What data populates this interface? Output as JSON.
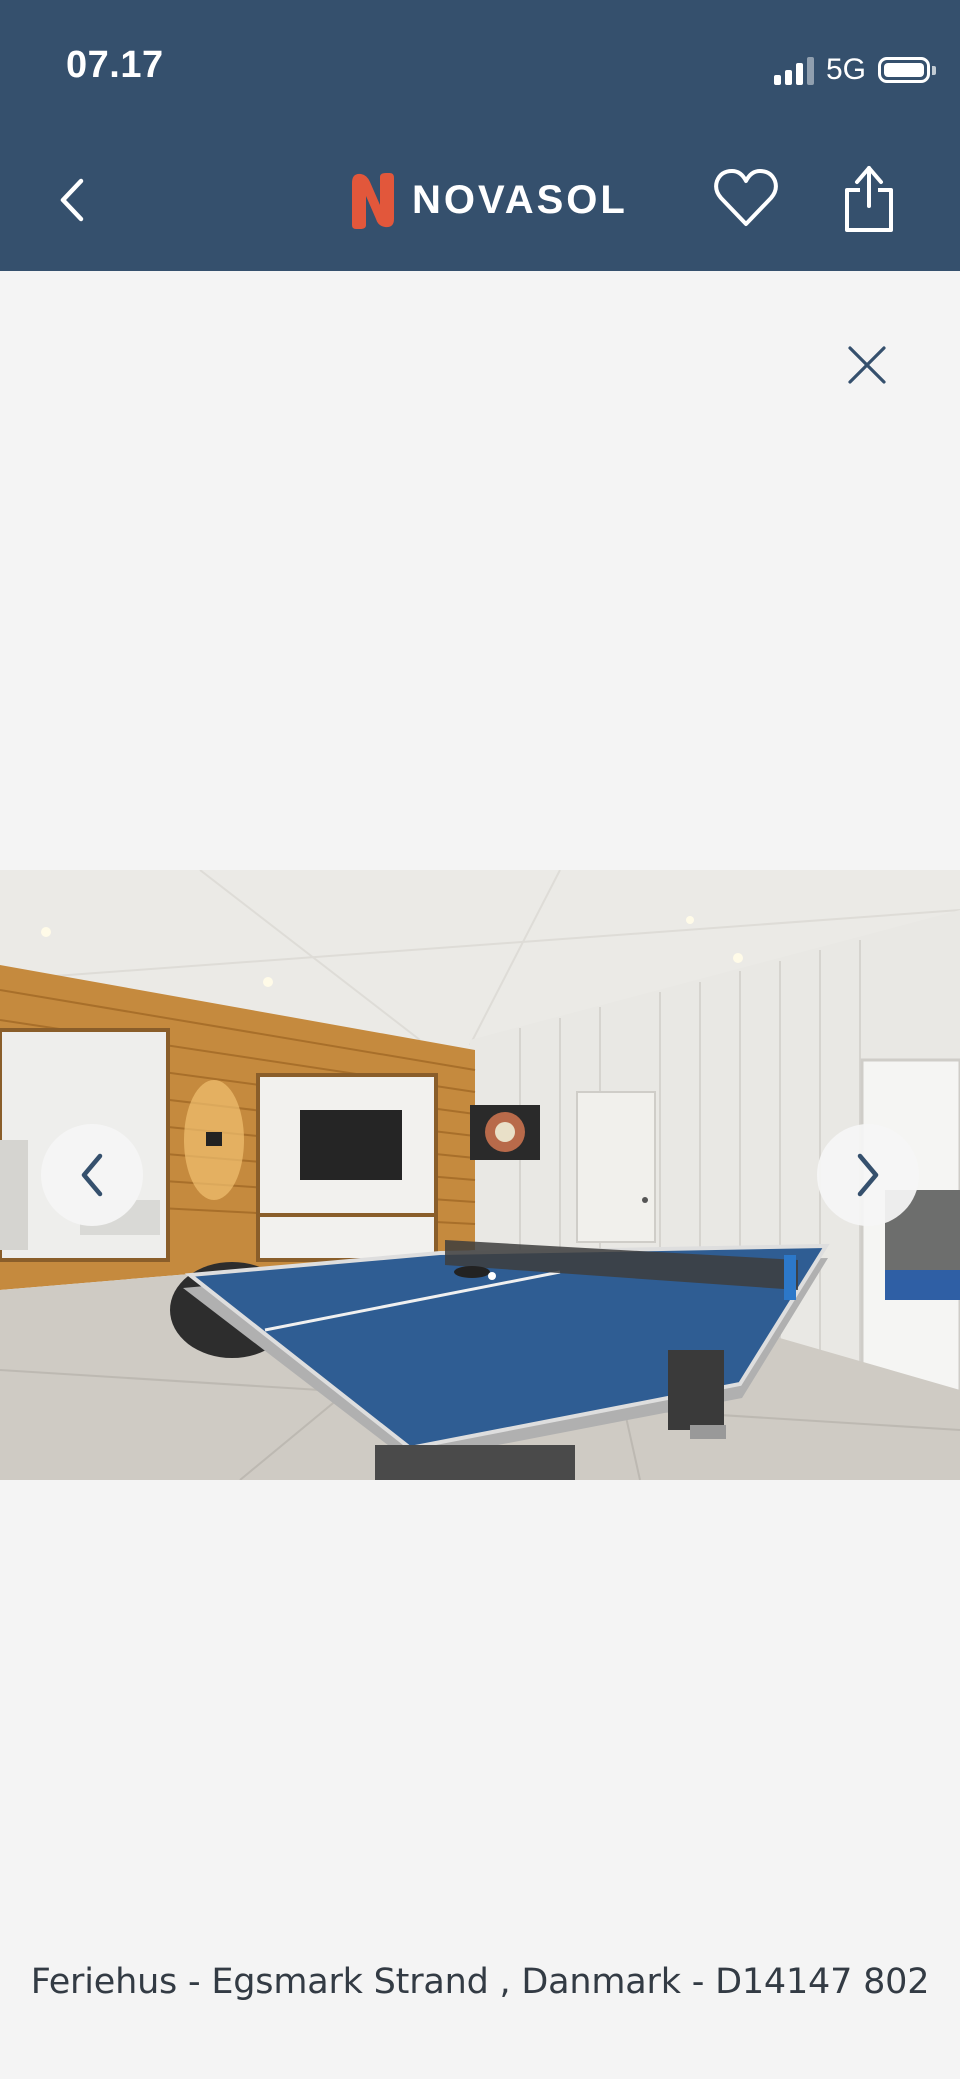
{
  "status_bar": {
    "time": "07.17",
    "network": "5G"
  },
  "header": {
    "brand_name": "NOVASOL",
    "background_color": "#35506d",
    "logo_color": "#e2573b",
    "icons": {
      "back": "chevron-left-icon",
      "favorite": "heart-icon",
      "share": "share-icon"
    }
  },
  "gallery": {
    "icons": {
      "close": "close-icon",
      "previous": "chevron-left-icon",
      "next": "chevron-right-icon"
    },
    "caption": "Feriehus - Egsmark Strand , Danmark - D14147 802"
  }
}
